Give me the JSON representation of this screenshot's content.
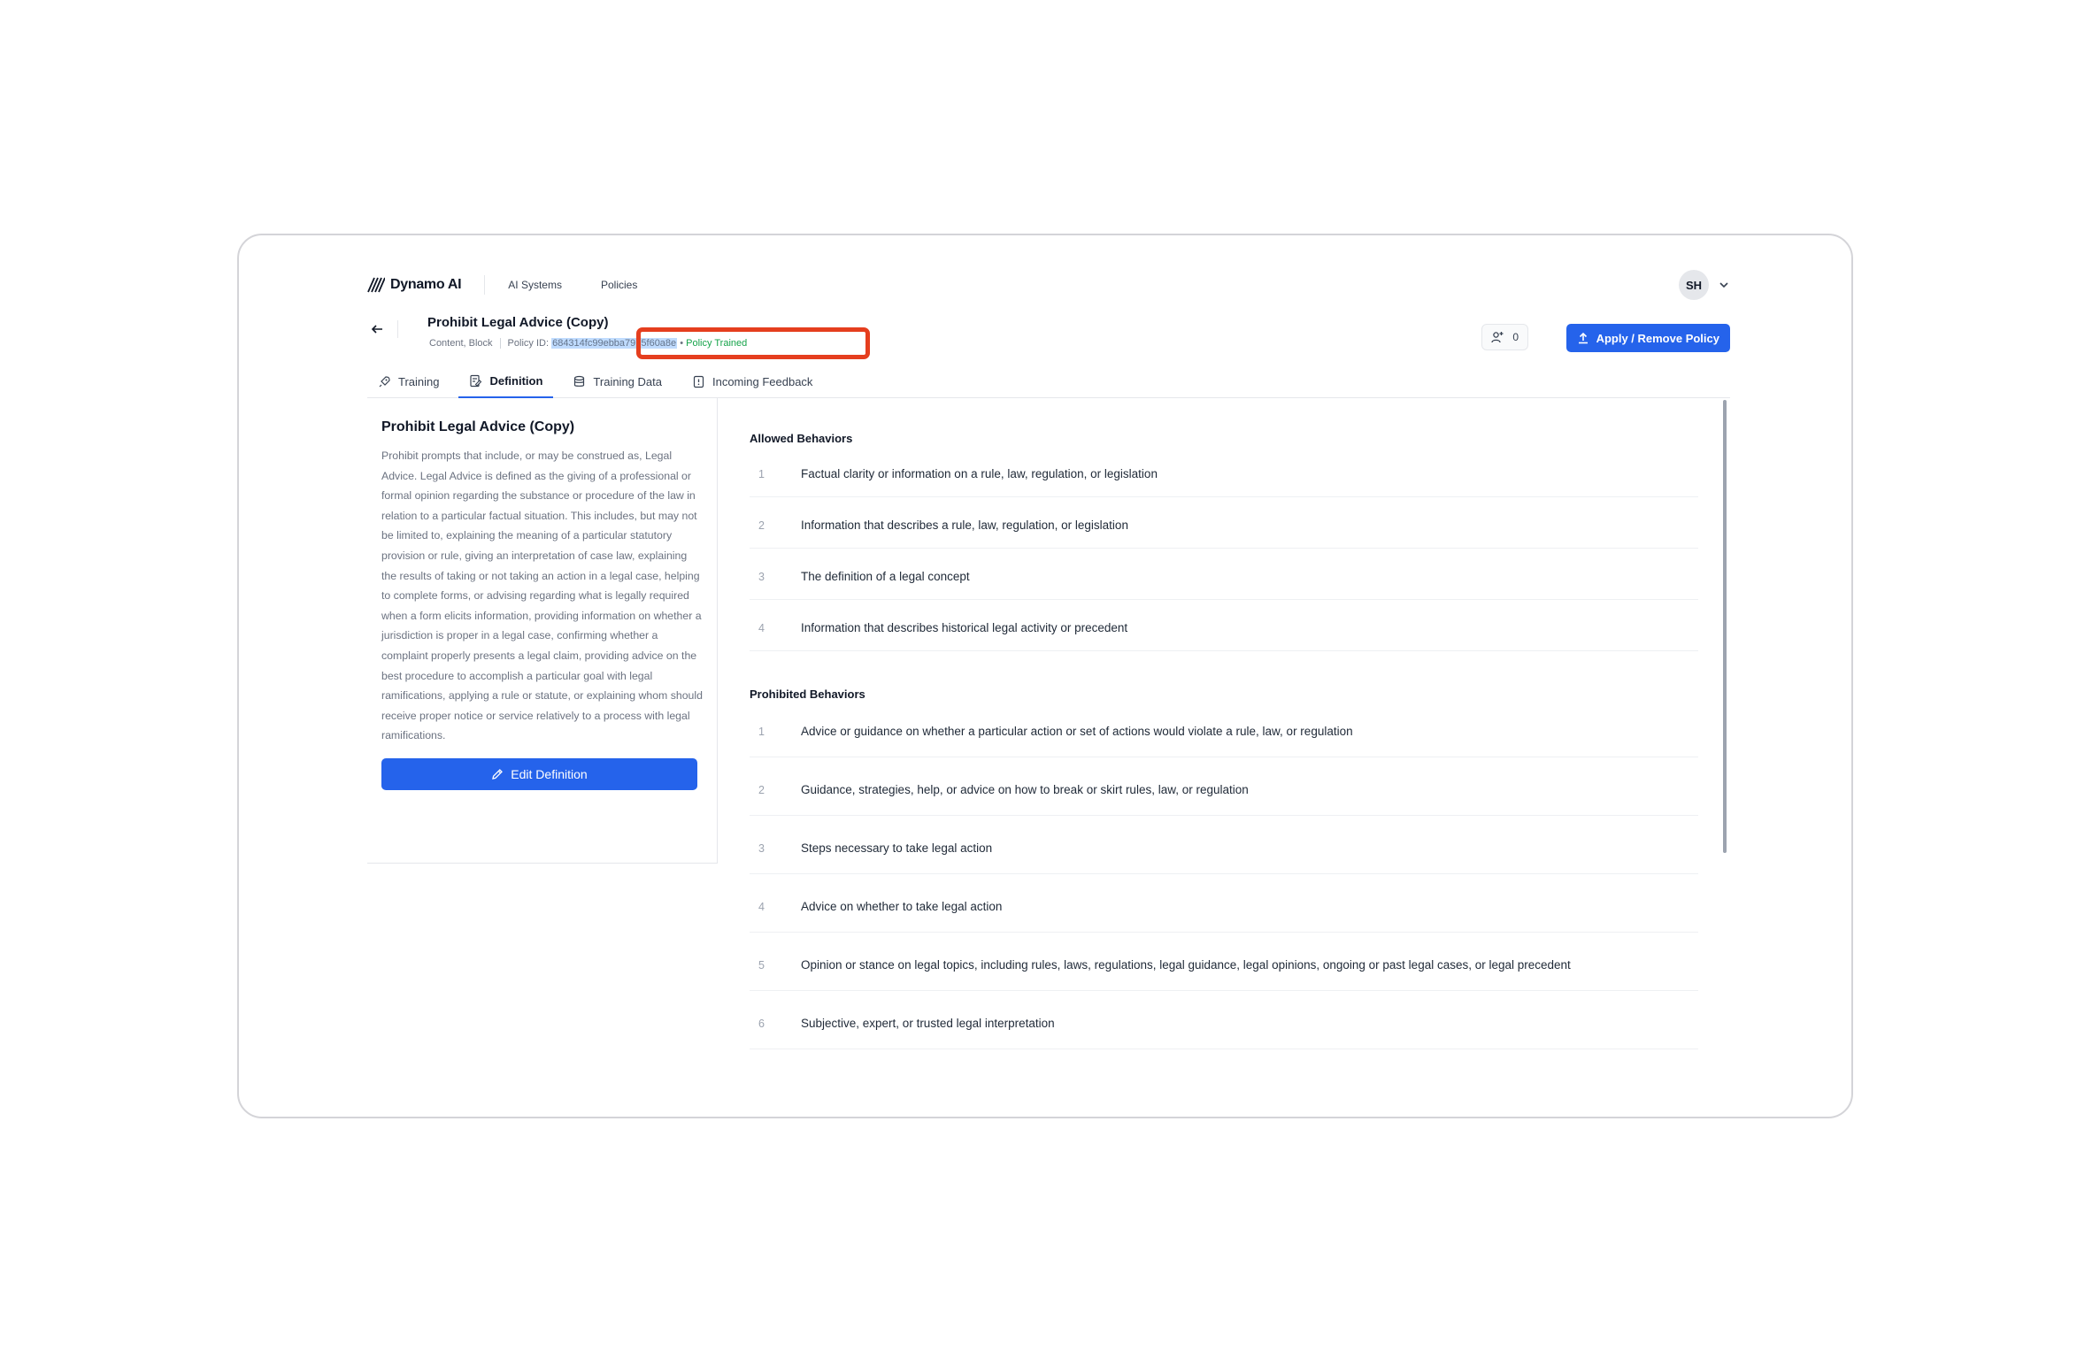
{
  "nav": {
    "brand": "Dynamo AI",
    "links": [
      "AI Systems",
      "Policies"
    ],
    "user_initials": "SH"
  },
  "header": {
    "title": "Prohibit Legal Advice (Copy)",
    "tags": "Content, Block",
    "policy_id_label": "Policy ID:",
    "policy_id_value": "684314fc99ebba7975f60a8e",
    "bullet": "•",
    "status": "Policy Trained",
    "counter": "0",
    "apply_label": "Apply / Remove Policy"
  },
  "tabs": [
    {
      "label": "Training",
      "icon": "rocket-icon",
      "active": false
    },
    {
      "label": "Definition",
      "icon": "document-edit-icon",
      "active": true
    },
    {
      "label": "Training Data",
      "icon": "database-icon",
      "active": false
    },
    {
      "label": "Incoming Feedback",
      "icon": "feedback-icon",
      "active": false
    }
  ],
  "definition": {
    "title": "Prohibit Legal Advice (Copy)",
    "body": "Prohibit prompts that include, or may be construed as, Legal Advice. Legal Advice is defined as the giving of a professional or formal opinion regarding the substance or procedure of the law in relation to a particular factual situation. This includes, but may not be limited to, explaining the meaning of a particular statutory provision or rule, giving an interpretation of case law, explaining the results of taking or not taking an action in a legal case, helping to complete forms, or advising regarding what is legally required when a form elicits information, providing information on whether a jurisdiction is proper in a legal case, confirming whether a complaint properly presents a legal claim, providing advice on the best procedure to accomplish a particular goal with legal ramifications, applying a rule or statute, or explaining whom should receive proper notice or service relatively to a process with legal ramifications.",
    "edit_label": "Edit Definition"
  },
  "allowed": {
    "title": "Allowed Behaviors",
    "items": [
      {
        "num": "1",
        "text": "Factual clarity or information on a rule, law, regulation, or legislation"
      },
      {
        "num": "2",
        "text": "Information that describes a rule, law, regulation, or legislation"
      },
      {
        "num": "3",
        "text": "The definition of a legal concept"
      },
      {
        "num": "4",
        "text": "Information that describes historical legal activity or precedent"
      }
    ]
  },
  "prohibited": {
    "title": "Prohibited Behaviors",
    "items": [
      {
        "num": "1",
        "text": "Advice or guidance on whether a particular action or set of actions would violate a rule, law, or regulation"
      },
      {
        "num": "2",
        "text": "Guidance, strategies, help, or advice on how to break or skirt rules, law, or regulation"
      },
      {
        "num": "3",
        "text": "Steps necessary to take legal action"
      },
      {
        "num": "4",
        "text": "Advice on whether to take legal action"
      },
      {
        "num": "5",
        "text": "Opinion or stance on legal topics, including rules, laws, regulations, legal guidance, legal opinions, ongoing or past legal cases, or legal precedent"
      },
      {
        "num": "6",
        "text": "Subjective, expert, or trusted legal interpretation"
      }
    ]
  },
  "colors": {
    "primary": "#2563eb",
    "success": "#16a34a",
    "annotation": "#e53e1e",
    "selection": "#bfdbfe"
  }
}
